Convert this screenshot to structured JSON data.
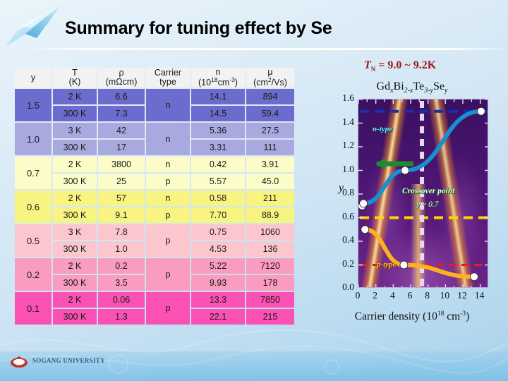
{
  "slide": {
    "title": "Summary for tuning effect by Se",
    "footer_text": "SOGANG UNIVERSITY"
  },
  "table": {
    "headers": {
      "y": "y",
      "temperature": "T",
      "temperature_unit": "(K)",
      "resistivity": "ρ",
      "resistivity_unit": "(mΩcm)",
      "carrier": "Carrier",
      "carrier_2": "type",
      "density": "n",
      "density_unit_pre": "(10",
      "density_unit_sup": "18",
      "density_unit_mid": "cm",
      "density_unit_sup2": "-3",
      "density_unit_post": ")",
      "mobility": "μ",
      "mobility_unit_pre": "(cm",
      "mobility_unit_sup": "2",
      "mobility_unit_post": "/Vs)"
    },
    "groups": [
      {
        "y": "1.5",
        "color": "#6c6cce",
        "carrier": "n",
        "rows": [
          {
            "T": "2 K",
            "rho": "6.6",
            "n": "14.1",
            "mu": "894"
          },
          {
            "T": "300 K",
            "rho": "7.3",
            "n": "14.5",
            "mu": "59.4"
          }
        ]
      },
      {
        "y": "1.0",
        "color": "#a9a9e0",
        "carrier": "n",
        "rows": [
          {
            "T": "3 K",
            "rho": "42",
            "n": "5.36",
            "mu": "27.5"
          },
          {
            "T": "300 K",
            "rho": "17",
            "n": "3.31",
            "mu": "111"
          }
        ]
      },
      {
        "y": "0.7",
        "color": "#fcfcc8",
        "carrier": null,
        "rows": [
          {
            "T": "2 K",
            "rho": "3800",
            "n": "0.42",
            "mu": "3.91",
            "carrier": "n"
          },
          {
            "T": "300 K",
            "rho": "25",
            "n": "5.57",
            "mu": "45.0",
            "carrier": "p"
          }
        ]
      },
      {
        "y": "0.6",
        "color": "#f7f482",
        "carrier": null,
        "rows": [
          {
            "T": "2 K",
            "rho": "57",
            "n": "0.58",
            "mu": "211",
            "carrier": "n"
          },
          {
            "T": "300 K",
            "rho": "9.1",
            "n": "7.70",
            "mu": "88.9",
            "carrier": "p"
          }
        ]
      },
      {
        "y": "0.5",
        "color": "#fbc6cd",
        "carrier": "p",
        "rows": [
          {
            "T": "3 K",
            "rho": "7.8",
            "n": "0.75",
            "mu": "1060"
          },
          {
            "T": "300 K",
            "rho": "1.0",
            "n": "4.53",
            "mu": "136"
          }
        ]
      },
      {
        "y": "0.2",
        "color": "#fa9cc0",
        "carrier": "p",
        "rows": [
          {
            "T": "2 K",
            "rho": "0.2",
            "n": "5.22",
            "mu": "7120"
          },
          {
            "T": "300 K",
            "rho": "3.5",
            "n": "9.93",
            "mu": "178"
          }
        ]
      },
      {
        "y": "0.1",
        "color": "#fb51b4",
        "carrier": "p",
        "rows": [
          {
            "T": "2 K",
            "rho": "0.06",
            "n": "13.3",
            "mu": "7850"
          },
          {
            "T": "300 K",
            "rho": "1.3",
            "n": "22.1",
            "mu": "215"
          }
        ]
      }
    ]
  },
  "figure": {
    "tn_symbol": "T",
    "tn_sub": "N",
    "tn_value": " = 9.0 ~ 9.2K",
    "formula": {
      "gd": "Gd",
      "gd_sub": "x",
      "bi": "Bi",
      "bi_sub": "2-x",
      "te": "Te",
      "te_sub": "3-y",
      "se": "Se",
      "se_sub": "y"
    },
    "annotations": {
      "n_type": "n-type",
      "p_type": "p-type",
      "crossover": "Crossover point",
      "crossover_value": "y ~ 0.7"
    },
    "colors": {
      "n_curve": "#1a8fd0",
      "p_curve": "#ffb020",
      "arrow": "#1f8a30",
      "dashed_blue": "#1a2fb0",
      "dashed_yellow": "#ffd400",
      "dashed_red": "#e02020",
      "dashed_white": "#e8d8f0",
      "tn_text": "#9e1616"
    }
  },
  "chart_data": {
    "type": "line",
    "title": "GdxBi2-xTe3-ySey",
    "xlabel": "Carrier density (10^18 cm^-3)",
    "ylabel": "y",
    "xlim": [
      0,
      15
    ],
    "ylim": [
      0.0,
      1.6
    ],
    "xticks": [
      0,
      2,
      4,
      6,
      8,
      10,
      12,
      14
    ],
    "yticks": [
      0.0,
      0.2,
      0.4,
      0.6,
      0.8,
      1.0,
      1.2,
      1.4,
      1.6
    ],
    "grid": false,
    "legend": [
      "n-type",
      "p-type"
    ],
    "series": [
      {
        "name": "n-type",
        "color": "#1a8fd0",
        "points": [
          {
            "x": 0.42,
            "y": 0.7
          },
          {
            "x": 0.58,
            "y": 0.72
          },
          {
            "x": 5.36,
            "y": 1.0
          },
          {
            "x": 14.1,
            "y": 1.5
          }
        ]
      },
      {
        "name": "p-type",
        "color": "#ffb020",
        "points": [
          {
            "x": 0.75,
            "y": 0.5
          },
          {
            "x": 5.22,
            "y": 0.2
          },
          {
            "x": 13.3,
            "y": 0.1
          }
        ]
      }
    ],
    "reference_lines": [
      {
        "orientation": "horizontal",
        "value": 1.5,
        "color": "#1a2fb0",
        "style": "dashed"
      },
      {
        "orientation": "horizontal",
        "value": 0.6,
        "color": "#ffd400",
        "style": "dashed"
      },
      {
        "orientation": "horizontal",
        "value": 0.2,
        "color": "#e02020",
        "style": "dashed"
      },
      {
        "orientation": "vertical",
        "value": 7.3,
        "color": "#e8d8f0",
        "style": "dashed"
      }
    ],
    "annotations": [
      {
        "text": "Crossover point",
        "x": 6.0,
        "y": 0.78
      },
      {
        "text": "y ~ 0.7",
        "x": 7.2,
        "y": 0.66
      },
      {
        "text": "n-type",
        "x": 1.6,
        "y": 1.3
      },
      {
        "text": "p-type",
        "x": 1.8,
        "y": 0.12
      }
    ]
  }
}
